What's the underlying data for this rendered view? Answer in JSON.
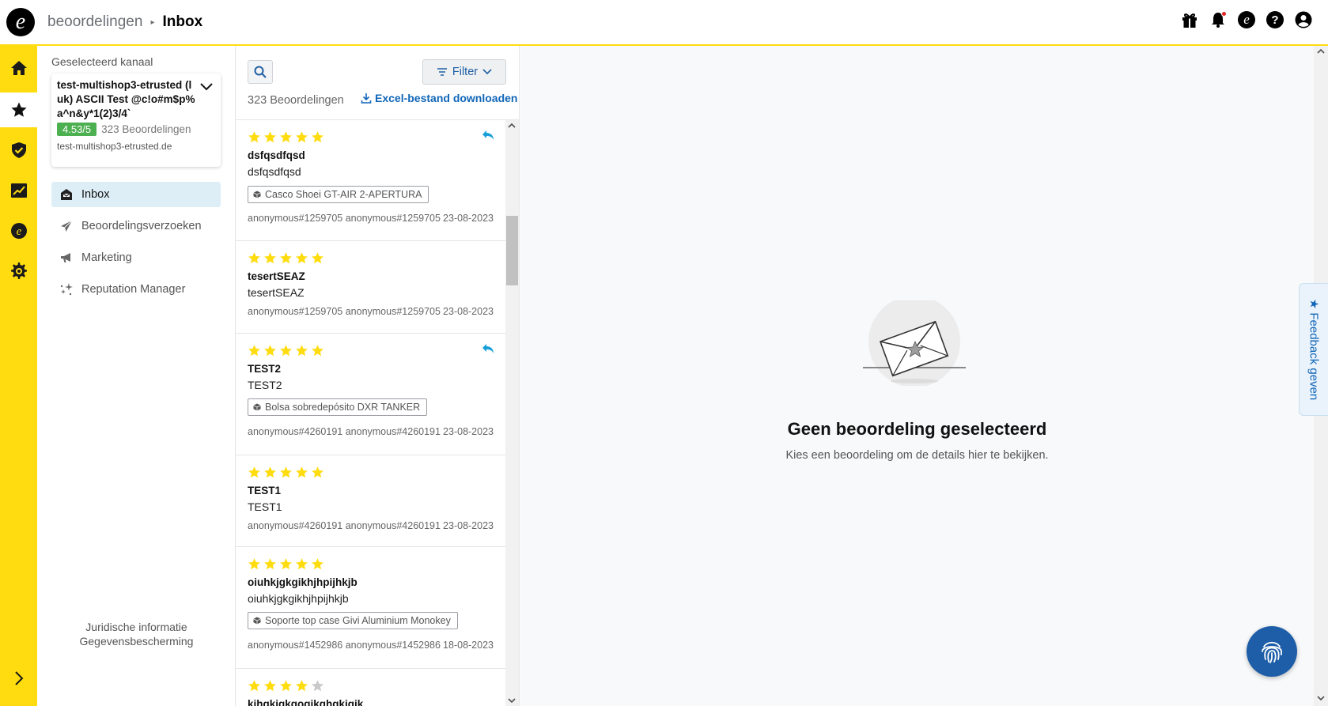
{
  "header": {
    "logo_letter": "e",
    "breadcrumb_parent": "beoordelingen",
    "breadcrumb_current": "Inbox",
    "icons": [
      "gift-icon",
      "bell-icon",
      "etrusted-icon",
      "help-icon",
      "account-icon"
    ],
    "has_notification_dot": true
  },
  "rail": {
    "items": [
      "home-icon",
      "star-icon",
      "shield-check-icon",
      "chart-icon",
      "etrusted-icon",
      "gear-icon"
    ],
    "active_index": 1,
    "expand_icon": "chevron-right-icon"
  },
  "sidebar": {
    "channel_label": "Geselecteerd kanaal",
    "channel": {
      "name": "test-multishop3-etrusted (luk) ASCII Test @c!o#m$p%a^n&y*1(2)3/4`",
      "rating": "4.53/5",
      "review_count": "323 Beoordelingen",
      "domain": "test-multishop3-etrusted.de"
    },
    "nav": [
      {
        "label": "Inbox",
        "icon": "inbox-icon",
        "active": true
      },
      {
        "label": "Beoordelingsverzoeken",
        "icon": "send-icon",
        "active": false
      },
      {
        "label": "Marketing",
        "icon": "megaphone-icon",
        "active": false
      },
      {
        "label": "Reputation Manager",
        "icon": "sparkle-icon",
        "active": false
      }
    ],
    "legal": {
      "juridisch": "Juridische informatie",
      "privacy": "Gegevensbescherming"
    }
  },
  "list": {
    "filter_label": "Filter",
    "count": "323 Beoordelingen",
    "excel_label": "Excel-bestand downloaden",
    "reviews": [
      {
        "stars": 5,
        "title": "dsfqsdfqsd",
        "text": "dsfqsdfqsd",
        "tag": "Casco Shoei GT-AIR 2-APERTURA",
        "author": "anonymous#1259705 anonymous#1259705",
        "date": "23-08-2023",
        "replied": true
      },
      {
        "stars": 5,
        "title": "tesertSEAZ",
        "text": "tesertSEAZ",
        "tag": null,
        "author": "anonymous#1259705 anonymous#1259705",
        "date": "23-08-2023",
        "replied": false
      },
      {
        "stars": 5,
        "title": "TEST2",
        "text": "TEST2",
        "tag": "Bolsa sobredepósito DXR TANKER",
        "author": "anonymous#4260191 anonymous#4260191",
        "date": "23-08-2023",
        "replied": true
      },
      {
        "stars": 5,
        "title": "TEST1",
        "text": "TEST1",
        "tag": null,
        "author": "anonymous#4260191 anonymous#4260191",
        "date": "23-08-2023",
        "replied": false
      },
      {
        "stars": 5,
        "title": "oiuhkjgkgikhjhpijhkjb",
        "text": "oiuhkjgkgikhjhpijhkjb",
        "tag": "Soporte top case Givi Aluminium Monokey",
        "author": "anonymous#1452986 anonymous#1452986",
        "date": "18-08-2023",
        "replied": false
      },
      {
        "stars": 4,
        "title": "kihgkigkgogikghgkigik",
        "text": "",
        "tag": null,
        "author": "",
        "date": "",
        "replied": false
      }
    ]
  },
  "main": {
    "empty_title": "Geen beoordeling geselecteerd",
    "empty_subtitle": "Kies een beoordeling om de details hier te bekijken.",
    "feedback_label": "★ Feedback geven"
  },
  "colors": {
    "brand_yellow": "#ffdc0f",
    "star_yellow": "#ffdc0f",
    "star_grey": "#c9c9c9",
    "link_blue": "#1166b8",
    "rating_green": "#4caf50",
    "reply_blue": "#1aa0d8",
    "fab_blue": "#1e5ea8"
  }
}
